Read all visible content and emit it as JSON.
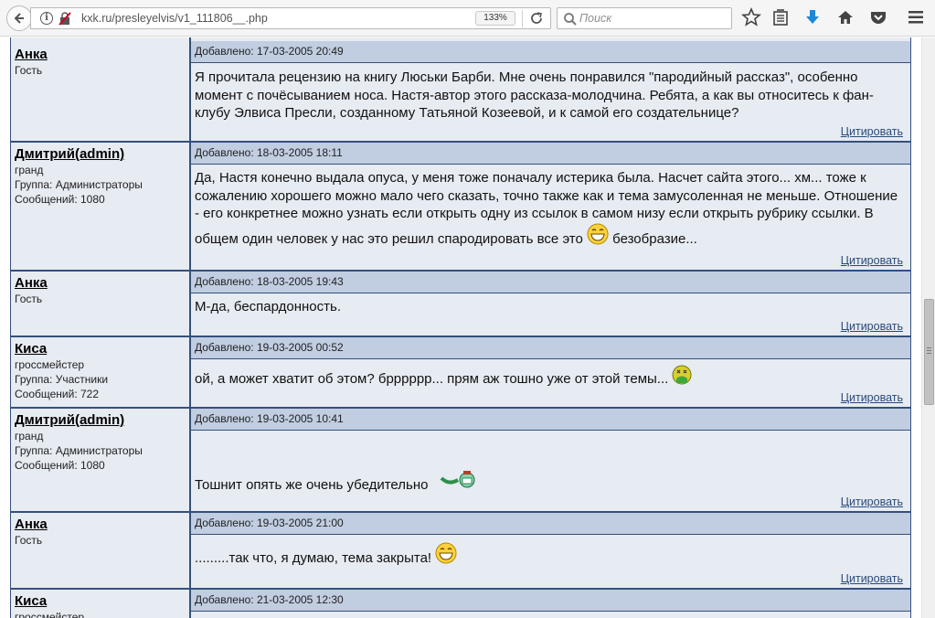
{
  "browser": {
    "url": "kxk.ru/presleyelvis/v1_111806__.php",
    "zoom": "133%",
    "search_placeholder": "Поиск"
  },
  "posts": [
    {
      "author": "Анка",
      "info": [
        "Гость"
      ],
      "date": "Добавлено: 17-03-2005 20:49",
      "text": "Я прочитала рецензию на книгу Люськи Барби. Мне очень понравился \"пародийный рассказ\", особенно момент с почёсыванием носа. Настя-автор этого рассказа-молодчина. Ребята, а как вы относитесь к фан-клубу Элвиса Пресли, созданному Татьяной Козеевой, и к самой его создательнице?",
      "cite": "Цитировать"
    },
    {
      "author": "Дмитрий(admin)",
      "info": [
        "гранд",
        "Группа: Администраторы",
        "Сообщений: 1080"
      ],
      "date": "Добавлено: 18-03-2005 18:11",
      "text": "Да, Настя конечно выдала опуса, у меня тоже поначалу истерика была. Насчет сайта этого... хм... тоже к сожалению хорошего можно мало чего сказать, точно также как и тема замусоленная не меньше. Отношение - его конкретнее можно узнать если открыть одну из ссылок в самом низу если открыть рубрику ссылки. В общем один человек у нас это решил спародировать все это",
      "text_after": "безобразие...",
      "cite": "Цитировать"
    },
    {
      "author": "Анка",
      "info": [
        "Гость"
      ],
      "date": "Добавлено: 18-03-2005 19:43",
      "text": "М-да, беспардонность.",
      "cite": "Цитировать"
    },
    {
      "author": "Киса",
      "info": [
        "гроссмейстер",
        "Группа: Участники",
        "Сообщений: 722"
      ],
      "date": "Добавлено: 19-03-2005 00:52",
      "text": "ой, а может хватит об этом? брррррр... прям аж тошно уже от этой темы...",
      "cite": "Цитировать"
    },
    {
      "author": "Дмитрий(admin)",
      "info": [
        "гранд",
        "Группа: Администраторы",
        "Сообщений: 1080"
      ],
      "date": "Добавлено: 19-03-2005 10:41",
      "text": "Тошнит опять же очень убедительно",
      "cite": "Цитировать"
    },
    {
      "author": "Анка",
      "info": [
        "Гость"
      ],
      "date": "Добавлено: 19-03-2005 21:00",
      "text": ".........так что, я думаю, тема закрыта!",
      "cite": "Цитировать"
    },
    {
      "author": "Киса",
      "info": [
        "гроссмейстер"
      ],
      "date": "Добавлено: 21-03-2005 12:30",
      "text": "",
      "cite": ""
    }
  ]
}
